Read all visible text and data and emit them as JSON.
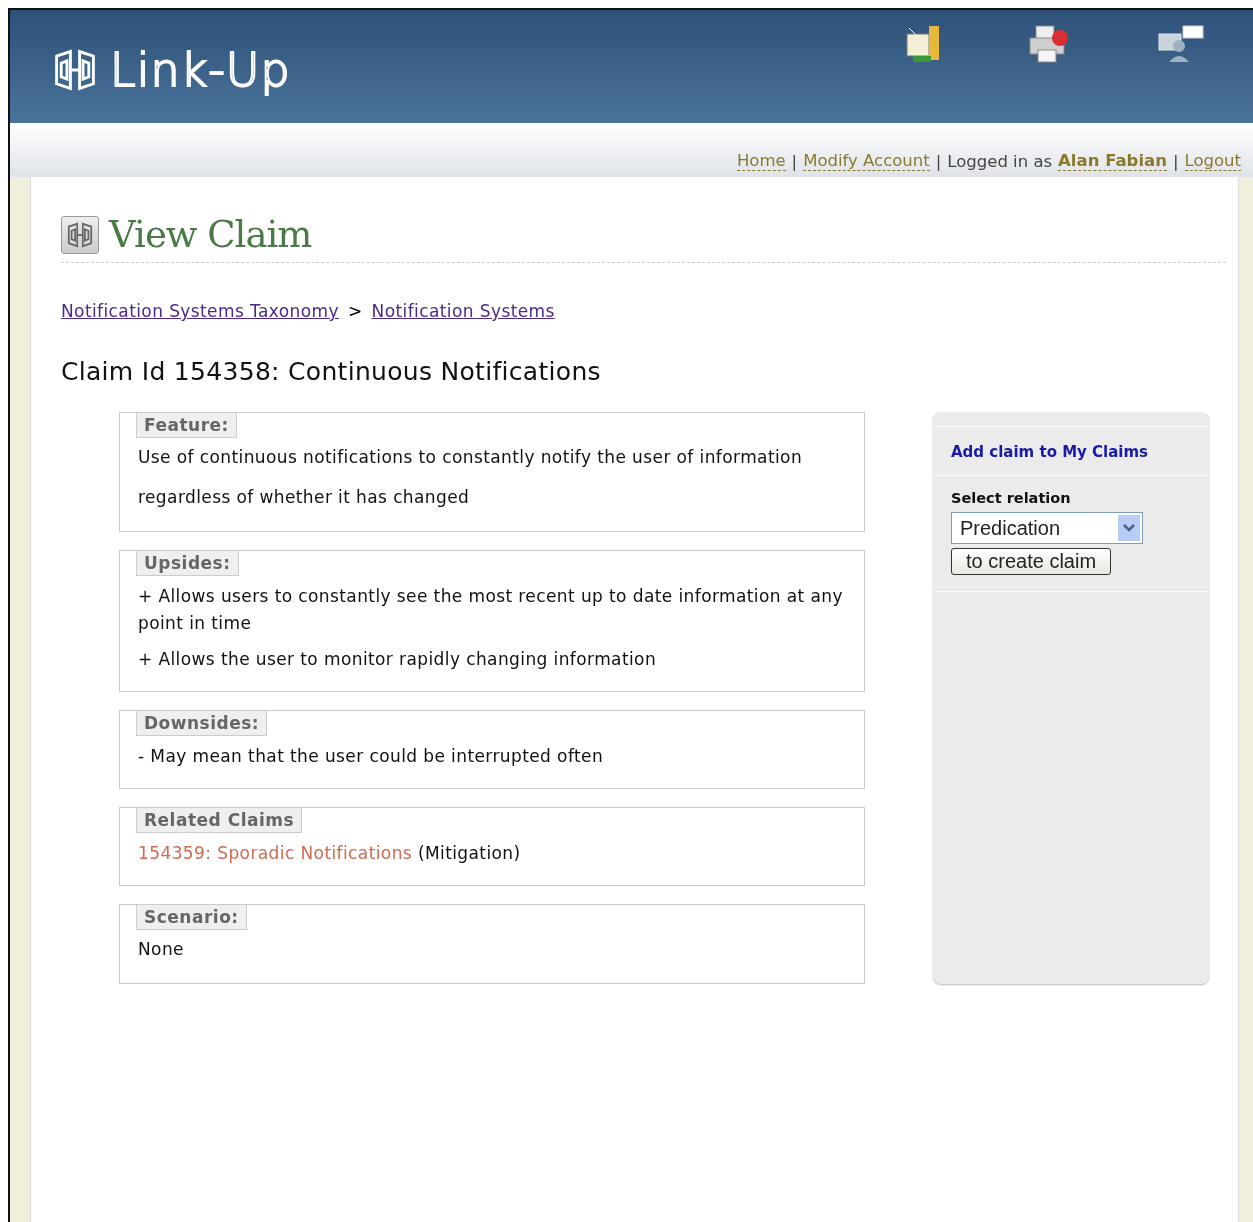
{
  "header": {
    "logo": "Link-Up"
  },
  "nav": [
    {
      "kind": "link",
      "text": "Home"
    },
    {
      "kind": "sep",
      "text": "|"
    },
    {
      "kind": "link",
      "text": "Modify Account"
    },
    {
      "kind": "sep",
      "text": "|"
    },
    {
      "kind": "text",
      "text": "Logged in as"
    },
    {
      "kind": "user",
      "text": "Alan Fabian"
    },
    {
      "kind": "sep",
      "text": "|"
    },
    {
      "kind": "link",
      "text": "Logout"
    }
  ],
  "page_title": "View Claim",
  "breadcrumbs": [
    {
      "kind": "link",
      "text": "Notification Systems Taxonomy"
    },
    {
      "kind": "sep",
      "text": ">"
    },
    {
      "kind": "link",
      "text": "Notification Systems"
    }
  ],
  "claim_heading": "Claim Id 154358: Continuous Notifications",
  "sections": [
    {
      "legend": "Feature:",
      "kind": "paragraph",
      "text": "Use of continuous notifications to constantly notify the user of information regardless of whether it has changed"
    },
    {
      "legend": "Upsides:",
      "kind": "list",
      "items": [
        "+ Allows users to constantly see the most recent up to date information at any point in time",
        "+ Allows the user to monitor rapidly changing information"
      ]
    },
    {
      "legend": "Downsides:",
      "kind": "list",
      "items": [
        "- May mean that the user could be interrupted often"
      ]
    },
    {
      "legend": "Related Claims",
      "kind": "related",
      "links": [
        {
          "link": "154359: Sporadic Notifications",
          "note": "(Mitigation)"
        }
      ]
    },
    {
      "legend": "Scenario:",
      "kind": "paragraph",
      "text": "None"
    }
  ],
  "sidebar": {
    "add_link": "Add claim to My Claims",
    "select_label": "Select relation",
    "select_value": "Predication",
    "button": "to create claim"
  }
}
